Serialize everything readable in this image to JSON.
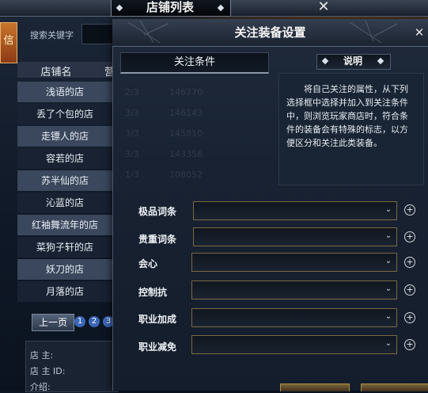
{
  "store_window": {
    "title": "店铺列表",
    "close_glyph": "✕",
    "side_banner": "信",
    "search_label": "搜索关键字",
    "columns": [
      "店铺名",
      "营"
    ],
    "stores": [
      "浅语的店",
      "丢了个包的店",
      "走镖人的店",
      "容若的店",
      "苏半仙的店",
      "沁蓝的店",
      "红袖舞流年的店",
      "菜狗子轩的店",
      "妖刀的店",
      "月落的店"
    ],
    "pagination": {
      "prev_label": "上一页",
      "pages": [
        "1",
        "2",
        "3"
      ]
    },
    "owner_info": [
      "店 主:",
      "店 主 ID:",
      "介绍:"
    ]
  },
  "dialog": {
    "title": "关注装备设置",
    "close_glyph": "✕",
    "tab_label": "关注条件",
    "desc_title": "说明",
    "desc_text": "将自己关注的属性，从下列选择框中选择并加入到关注条件中，则浏览玩家商店时，符合条件的装备会有特殊的标志，以方便区分和关注此类装备。",
    "faded_rows": [
      "2/3           146770",
      "3/3           146143",
      "3/3           145810",
      "3/3           143356",
      "1/3           108052"
    ],
    "fields": [
      {
        "label": "极品词条",
        "value": ""
      },
      {
        "label": "贵重词条",
        "value": ""
      },
      {
        "label": "会心",
        "value": ""
      },
      {
        "label": "控制抗",
        "value": ""
      },
      {
        "label": "职业加成",
        "value": ""
      },
      {
        "label": "职业减免",
        "value": ""
      }
    ],
    "add_glyph": "+",
    "chevron_glyph": "⌄"
  },
  "colors": {
    "accent_border": "#7a6a44",
    "page_badge": "#3b67b8"
  }
}
